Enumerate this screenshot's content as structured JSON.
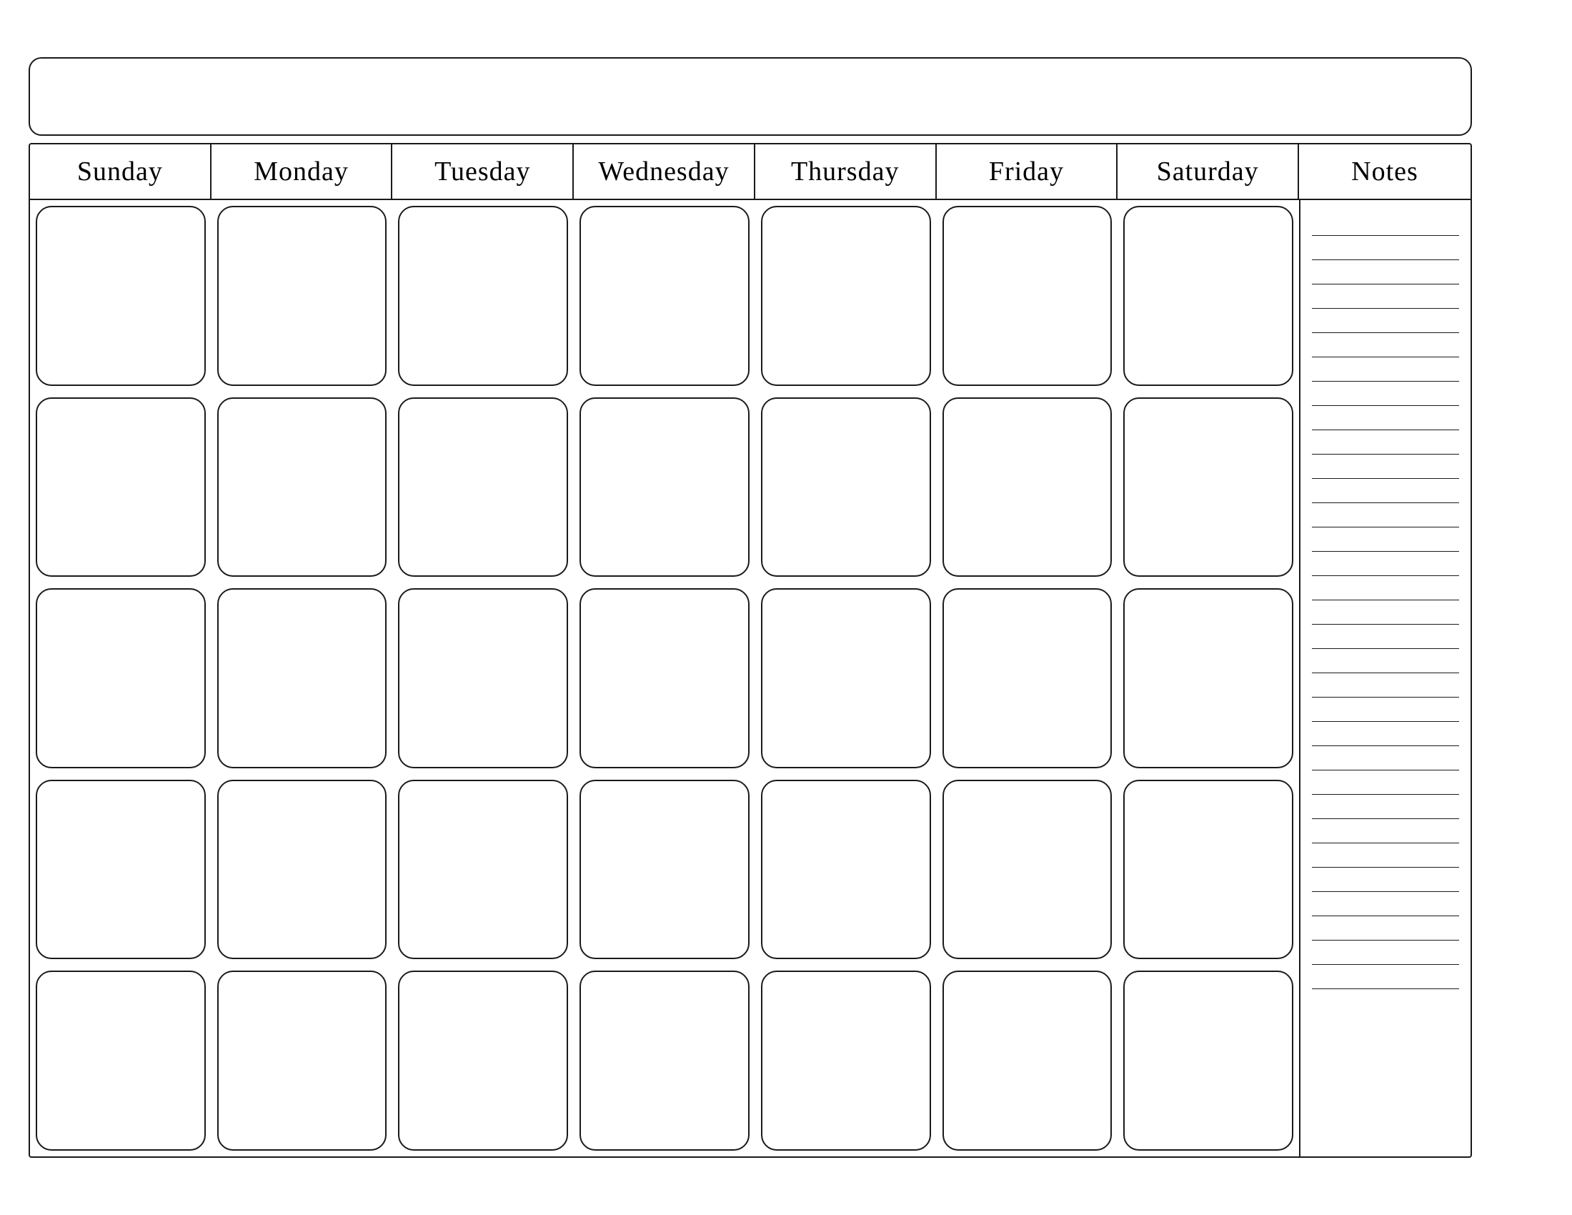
{
  "calendar": {
    "title": "",
    "days": [
      "Sunday",
      "Monday",
      "Tuesday",
      "Wednesday",
      "Thursday",
      "Friday",
      "Saturday"
    ],
    "notes_label": "Notes",
    "weeks": 5,
    "note_lines": 32
  }
}
